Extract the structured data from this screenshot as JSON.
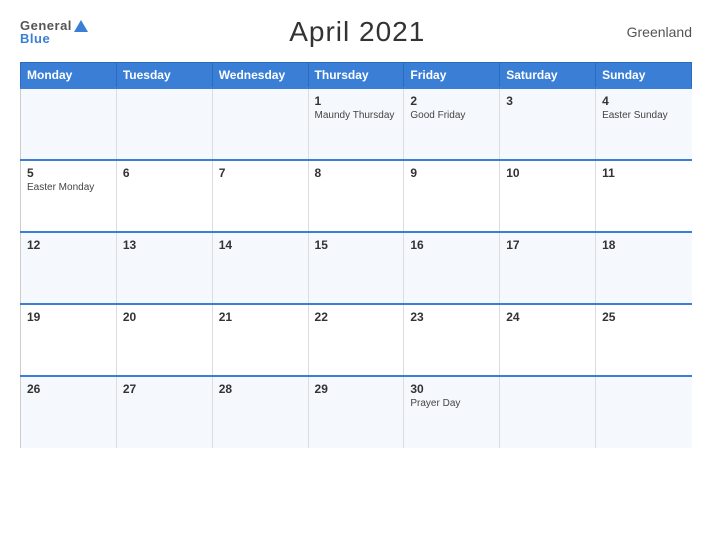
{
  "header": {
    "logo_general": "General",
    "logo_blue": "Blue",
    "title": "April 2021",
    "region": "Greenland"
  },
  "days_header": [
    "Monday",
    "Tuesday",
    "Wednesday",
    "Thursday",
    "Friday",
    "Saturday",
    "Sunday"
  ],
  "weeks": [
    [
      {
        "num": "",
        "events": []
      },
      {
        "num": "",
        "events": []
      },
      {
        "num": "",
        "events": []
      },
      {
        "num": "1",
        "events": [
          "Maundy Thursday"
        ]
      },
      {
        "num": "2",
        "events": [
          "Good Friday"
        ]
      },
      {
        "num": "3",
        "events": []
      },
      {
        "num": "4",
        "events": [
          "Easter Sunday"
        ]
      }
    ],
    [
      {
        "num": "5",
        "events": [
          "Easter Monday"
        ]
      },
      {
        "num": "6",
        "events": []
      },
      {
        "num": "7",
        "events": []
      },
      {
        "num": "8",
        "events": []
      },
      {
        "num": "9",
        "events": []
      },
      {
        "num": "10",
        "events": []
      },
      {
        "num": "11",
        "events": []
      }
    ],
    [
      {
        "num": "12",
        "events": []
      },
      {
        "num": "13",
        "events": []
      },
      {
        "num": "14",
        "events": []
      },
      {
        "num": "15",
        "events": []
      },
      {
        "num": "16",
        "events": []
      },
      {
        "num": "17",
        "events": []
      },
      {
        "num": "18",
        "events": []
      }
    ],
    [
      {
        "num": "19",
        "events": []
      },
      {
        "num": "20",
        "events": []
      },
      {
        "num": "21",
        "events": []
      },
      {
        "num": "22",
        "events": []
      },
      {
        "num": "23",
        "events": []
      },
      {
        "num": "24",
        "events": []
      },
      {
        "num": "25",
        "events": []
      }
    ],
    [
      {
        "num": "26",
        "events": []
      },
      {
        "num": "27",
        "events": []
      },
      {
        "num": "28",
        "events": []
      },
      {
        "num": "29",
        "events": []
      },
      {
        "num": "30",
        "events": [
          "Prayer Day"
        ]
      },
      {
        "num": "",
        "events": []
      },
      {
        "num": "",
        "events": []
      }
    ]
  ]
}
